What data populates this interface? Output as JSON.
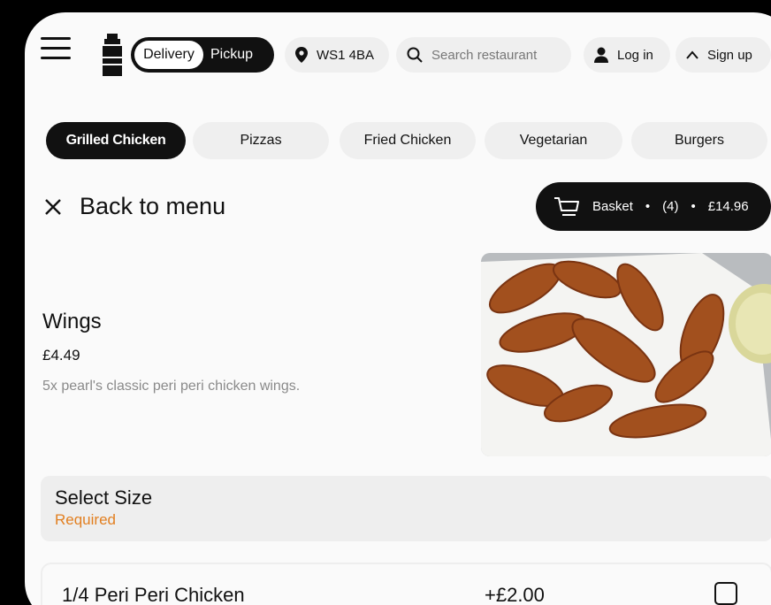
{
  "header": {
    "toggle": {
      "delivery": "Delivery",
      "pickup": "Pickup"
    },
    "location": "WS1 4BA",
    "search_placeholder": "Search restaurant",
    "login": "Log in",
    "signup": "Sign up"
  },
  "categories": [
    "Grilled Chicken",
    "Pizzas",
    "Fried Chicken",
    "Vegetarian",
    "Burgers"
  ],
  "nav": {
    "back": "Back to menu"
  },
  "basket": {
    "label": "Basket",
    "count": "(4)",
    "total": "£14.96"
  },
  "item": {
    "title": "Wings",
    "price": "£4.49",
    "description": "5x pearl's classic peri peri chicken wings."
  },
  "size_section": {
    "title": "Select Size",
    "required": "Required"
  },
  "options": [
    {
      "name": "1/4 Peri Peri Chicken",
      "price": "+£2.00",
      "checked": false
    }
  ]
}
